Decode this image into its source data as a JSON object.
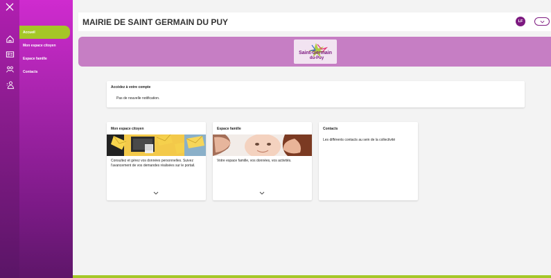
{
  "sidebar": {
    "items": [
      {
        "label": "Accueil",
        "icon": "home-icon",
        "active": true
      },
      {
        "label": "Mon espace citoyen",
        "icon": "id-card-icon"
      },
      {
        "label": "Espace famille",
        "icon": "family-icon"
      },
      {
        "label": "Contacts",
        "icon": "contacts-icon"
      }
    ]
  },
  "header": {
    "title": "MAIRIE DE SAINT GERMAIN DU PUY",
    "avatar_initials": "LF"
  },
  "banner": {
    "logo_line1": "Saint-Germain",
    "logo_line2": "du-Puy"
  },
  "notification": {
    "title": "Accédez à votre compte",
    "text": "Pas de nouvelle notification."
  },
  "tiles": [
    {
      "title": "Mon espace citoyen",
      "description": "Consultez et gérez vos données personnelles. Suivez l'avancement de vos demandes réalisées sur le portail."
    },
    {
      "title": "Espace famille",
      "description": "Votre espace famille, vos données, vos activités."
    },
    {
      "title": "Contacts",
      "description": "Les différents contacts au sein de la collectivité"
    }
  ],
  "colors": {
    "accent_green": "#a5c727",
    "brand_purple": "#7d1a80",
    "banner_pink": "#c67ec4"
  }
}
